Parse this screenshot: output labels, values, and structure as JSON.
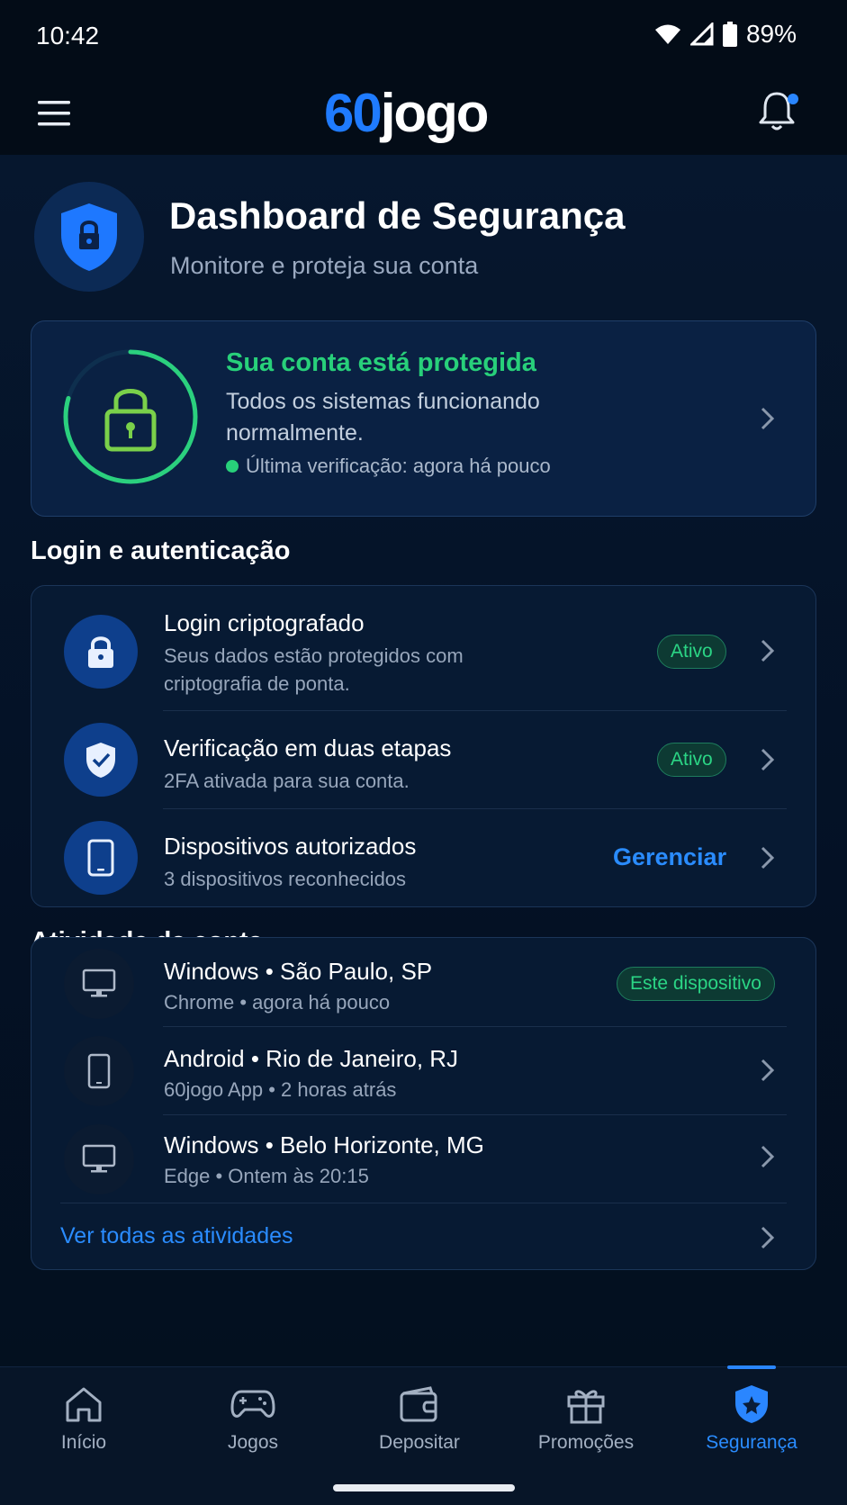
{
  "status_bar": {
    "time": "10:42",
    "battery": "89%"
  },
  "header": {
    "logo_prefix": "60",
    "logo_suffix": "jogo"
  },
  "hero": {
    "title": "Dashboard de Segurança",
    "subtitle": "Monitore e proteja sua conta"
  },
  "protection": {
    "title": "Sua conta está protegida",
    "text": "Todos os sistemas funcionando normalmente.",
    "last_check": "Última verificação: agora há pouco"
  },
  "login_section": {
    "title": "Login e autenticação",
    "items": [
      {
        "title": "Login criptografado",
        "subtitle": "Seus dados estão protegidos com criptografia de ponta.",
        "badge": "Ativo"
      },
      {
        "title": "Verificação em duas etapas",
        "subtitle": "2FA ativada para sua conta.",
        "badge": "Ativo"
      },
      {
        "title": "Dispositivos autorizados",
        "subtitle": "3 dispositivos reconhecidos",
        "action": "Gerenciar"
      }
    ]
  },
  "activity_section": {
    "title": "Atividade da conta",
    "items": [
      {
        "title": "Windows • São Paulo, SP",
        "subtitle": "Chrome • agora há pouco",
        "badge": "Este dispositivo",
        "device": "desktop-icon"
      },
      {
        "title": "Android • Rio de Janeiro, RJ",
        "subtitle": "60jogo App • 2 horas atrás",
        "device": "phone-icon"
      },
      {
        "title": "Windows • Belo Horizonte, MG",
        "subtitle": "Edge • Ontem às 20:15",
        "device": "desktop-icon"
      }
    ],
    "see_all": "Ver todas as atividades"
  },
  "bottom_nav": {
    "items": [
      {
        "label": "Início",
        "icon": "home-icon"
      },
      {
        "label": "Jogos",
        "icon": "gamepad-icon"
      },
      {
        "label": "Depositar",
        "icon": "wallet-icon"
      },
      {
        "label": "Promoções",
        "icon": "gift-icon"
      },
      {
        "label": "Segurança",
        "icon": "shield-icon",
        "active": true
      }
    ]
  },
  "colors": {
    "accent": "#2a8cff",
    "success": "#28d07a",
    "background": "#04101f"
  }
}
